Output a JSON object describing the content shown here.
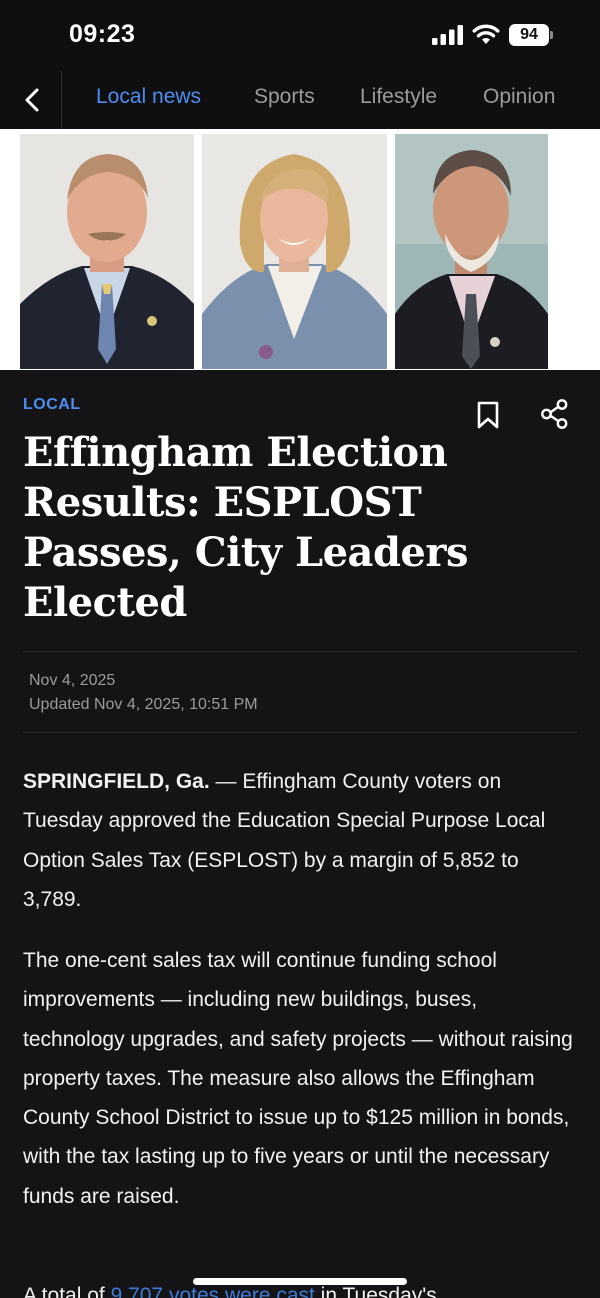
{
  "status_bar": {
    "time": "09:23",
    "battery": "94",
    "icons": [
      "signal-icon",
      "wifi-icon",
      "battery-icon"
    ]
  },
  "nav": {
    "back_icon": "chevron-left-icon",
    "tabs": [
      {
        "label": "Local news",
        "active": true
      },
      {
        "label": "Sports",
        "active": false
      },
      {
        "label": "Lifestyle",
        "active": false
      },
      {
        "label": "Opinion",
        "active": false
      }
    ],
    "accent": "#4d8df0"
  },
  "article": {
    "category": "LOCAL",
    "bookmark_icon": "bookmark-icon",
    "share_icon": "share-icon",
    "headline": "Effingham Election Results: ESPLOST Passes, City Leaders Elected",
    "date": "Nov 4, 2025",
    "updated": "Updated Nov 4, 2025, 10:51 PM",
    "p1_dateline": "SPRINGFIELD, Ga.",
    "p1_text": " — Effingham County voters on Tuesday approved the Education Special Purpose Local Option Sales Tax (ESPLOST) by a margin of 5,852 to 3,789.",
    "p2_text": "The one-cent sales tax will continue funding school improvements — including new buildings, buses, technology upgrades, and safety projects — without raising property taxes. The measure also allows the Effingham County School District to issue up to $125 million in bonds, with the tax lasting up to five years or until the necessary funds are raised.",
    "p3_start": "A total of ",
    "p3_link": "9,707 votes were cast",
    "p3_end": " in Tuesday's"
  }
}
